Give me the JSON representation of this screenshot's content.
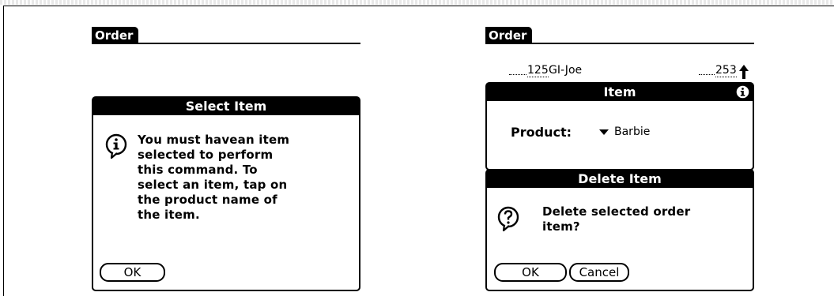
{
  "left_screen": {
    "form_title": "Order",
    "alert": {
      "title": "Select Item",
      "icon": "info-icon",
      "message_lines": [
        "You must havean item",
        "selected to perform",
        "this command.  To",
        "select an item, tap on",
        "the product name of",
        "the item."
      ],
      "ok_label": "OK"
    }
  },
  "right_screen": {
    "form_title": "Order",
    "list_row": {
      "quantity": "125",
      "product": "GI-Joe",
      "price": "253"
    },
    "item_dialog": {
      "title": "Item",
      "product_label": "Product:",
      "product_value": "Barbie"
    },
    "confirm_dialog": {
      "title": "Delete Item",
      "icon": "question-icon",
      "message_lines": [
        "Delete selected order",
        "item?"
      ],
      "ok_label": "OK",
      "cancel_label": "Cancel"
    }
  }
}
